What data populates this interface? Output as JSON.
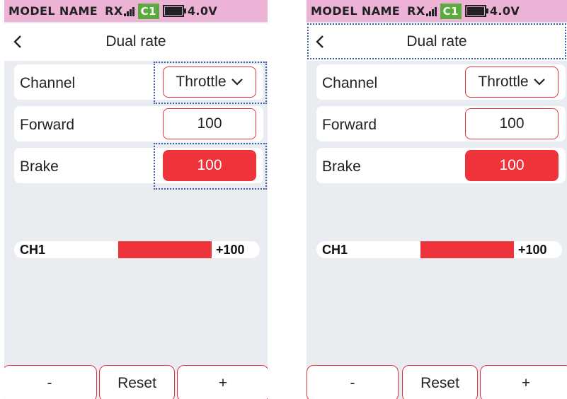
{
  "status_bar": {
    "model_name": "MODEL NAME",
    "rx_label": "RX",
    "channel_badge": "C1",
    "voltage": "4.0V",
    "icons": [
      "signal-bars-icon",
      "battery-icon"
    ]
  },
  "header": {
    "title": "Dual rate",
    "back_icon": "chevron-left-icon"
  },
  "settings": {
    "channel_label": "Channel",
    "channel_value": "Throttle",
    "forward_label": "Forward",
    "forward_value": "100",
    "brake_label": "Brake",
    "brake_value": "100"
  },
  "channel_bar": {
    "label": "CH1",
    "value_text": "+100",
    "level_percent": 100
  },
  "buttons": {
    "minus": "-",
    "reset": "Reset",
    "plus": "+"
  },
  "colors": {
    "accent_red": "#ee333b",
    "status_bar_pink": "#ecb3d6",
    "badge_green": "#5aaa3e",
    "focus_outline": "#3a5fa8",
    "screen_background": "#e9edf2"
  }
}
